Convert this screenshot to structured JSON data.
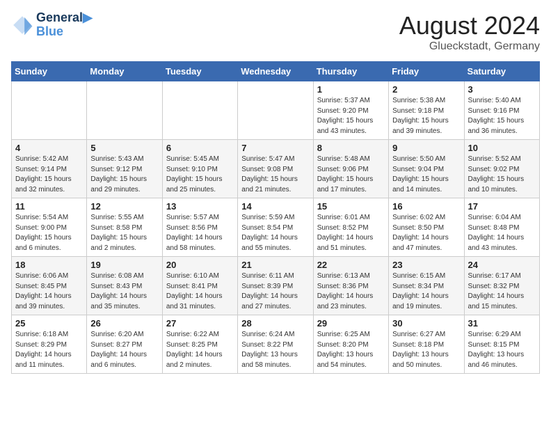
{
  "header": {
    "logo_line1": "General",
    "logo_line2": "Blue",
    "month_year": "August 2024",
    "location": "Glueckstadt, Germany"
  },
  "weekdays": [
    "Sunday",
    "Monday",
    "Tuesday",
    "Wednesday",
    "Thursday",
    "Friday",
    "Saturday"
  ],
  "weeks": [
    [
      {
        "day": "",
        "info": ""
      },
      {
        "day": "",
        "info": ""
      },
      {
        "day": "",
        "info": ""
      },
      {
        "day": "",
        "info": ""
      },
      {
        "day": "1",
        "info": "Sunrise: 5:37 AM\nSunset: 9:20 PM\nDaylight: 15 hours\nand 43 minutes."
      },
      {
        "day": "2",
        "info": "Sunrise: 5:38 AM\nSunset: 9:18 PM\nDaylight: 15 hours\nand 39 minutes."
      },
      {
        "day": "3",
        "info": "Sunrise: 5:40 AM\nSunset: 9:16 PM\nDaylight: 15 hours\nand 36 minutes."
      }
    ],
    [
      {
        "day": "4",
        "info": "Sunrise: 5:42 AM\nSunset: 9:14 PM\nDaylight: 15 hours\nand 32 minutes."
      },
      {
        "day": "5",
        "info": "Sunrise: 5:43 AM\nSunset: 9:12 PM\nDaylight: 15 hours\nand 29 minutes."
      },
      {
        "day": "6",
        "info": "Sunrise: 5:45 AM\nSunset: 9:10 PM\nDaylight: 15 hours\nand 25 minutes."
      },
      {
        "day": "7",
        "info": "Sunrise: 5:47 AM\nSunset: 9:08 PM\nDaylight: 15 hours\nand 21 minutes."
      },
      {
        "day": "8",
        "info": "Sunrise: 5:48 AM\nSunset: 9:06 PM\nDaylight: 15 hours\nand 17 minutes."
      },
      {
        "day": "9",
        "info": "Sunrise: 5:50 AM\nSunset: 9:04 PM\nDaylight: 15 hours\nand 14 minutes."
      },
      {
        "day": "10",
        "info": "Sunrise: 5:52 AM\nSunset: 9:02 PM\nDaylight: 15 hours\nand 10 minutes."
      }
    ],
    [
      {
        "day": "11",
        "info": "Sunrise: 5:54 AM\nSunset: 9:00 PM\nDaylight: 15 hours\nand 6 minutes."
      },
      {
        "day": "12",
        "info": "Sunrise: 5:55 AM\nSunset: 8:58 PM\nDaylight: 15 hours\nand 2 minutes."
      },
      {
        "day": "13",
        "info": "Sunrise: 5:57 AM\nSunset: 8:56 PM\nDaylight: 14 hours\nand 58 minutes."
      },
      {
        "day": "14",
        "info": "Sunrise: 5:59 AM\nSunset: 8:54 PM\nDaylight: 14 hours\nand 55 minutes."
      },
      {
        "day": "15",
        "info": "Sunrise: 6:01 AM\nSunset: 8:52 PM\nDaylight: 14 hours\nand 51 minutes."
      },
      {
        "day": "16",
        "info": "Sunrise: 6:02 AM\nSunset: 8:50 PM\nDaylight: 14 hours\nand 47 minutes."
      },
      {
        "day": "17",
        "info": "Sunrise: 6:04 AM\nSunset: 8:48 PM\nDaylight: 14 hours\nand 43 minutes."
      }
    ],
    [
      {
        "day": "18",
        "info": "Sunrise: 6:06 AM\nSunset: 8:45 PM\nDaylight: 14 hours\nand 39 minutes."
      },
      {
        "day": "19",
        "info": "Sunrise: 6:08 AM\nSunset: 8:43 PM\nDaylight: 14 hours\nand 35 minutes."
      },
      {
        "day": "20",
        "info": "Sunrise: 6:10 AM\nSunset: 8:41 PM\nDaylight: 14 hours\nand 31 minutes."
      },
      {
        "day": "21",
        "info": "Sunrise: 6:11 AM\nSunset: 8:39 PM\nDaylight: 14 hours\nand 27 minutes."
      },
      {
        "day": "22",
        "info": "Sunrise: 6:13 AM\nSunset: 8:36 PM\nDaylight: 14 hours\nand 23 minutes."
      },
      {
        "day": "23",
        "info": "Sunrise: 6:15 AM\nSunset: 8:34 PM\nDaylight: 14 hours\nand 19 minutes."
      },
      {
        "day": "24",
        "info": "Sunrise: 6:17 AM\nSunset: 8:32 PM\nDaylight: 14 hours\nand 15 minutes."
      }
    ],
    [
      {
        "day": "25",
        "info": "Sunrise: 6:18 AM\nSunset: 8:29 PM\nDaylight: 14 hours\nand 11 minutes."
      },
      {
        "day": "26",
        "info": "Sunrise: 6:20 AM\nSunset: 8:27 PM\nDaylight: 14 hours\nand 6 minutes."
      },
      {
        "day": "27",
        "info": "Sunrise: 6:22 AM\nSunset: 8:25 PM\nDaylight: 14 hours\nand 2 minutes."
      },
      {
        "day": "28",
        "info": "Sunrise: 6:24 AM\nSunset: 8:22 PM\nDaylight: 13 hours\nand 58 minutes."
      },
      {
        "day": "29",
        "info": "Sunrise: 6:25 AM\nSunset: 8:20 PM\nDaylight: 13 hours\nand 54 minutes."
      },
      {
        "day": "30",
        "info": "Sunrise: 6:27 AM\nSunset: 8:18 PM\nDaylight: 13 hours\nand 50 minutes."
      },
      {
        "day": "31",
        "info": "Sunrise: 6:29 AM\nSunset: 8:15 PM\nDaylight: 13 hours\nand 46 minutes."
      }
    ]
  ]
}
